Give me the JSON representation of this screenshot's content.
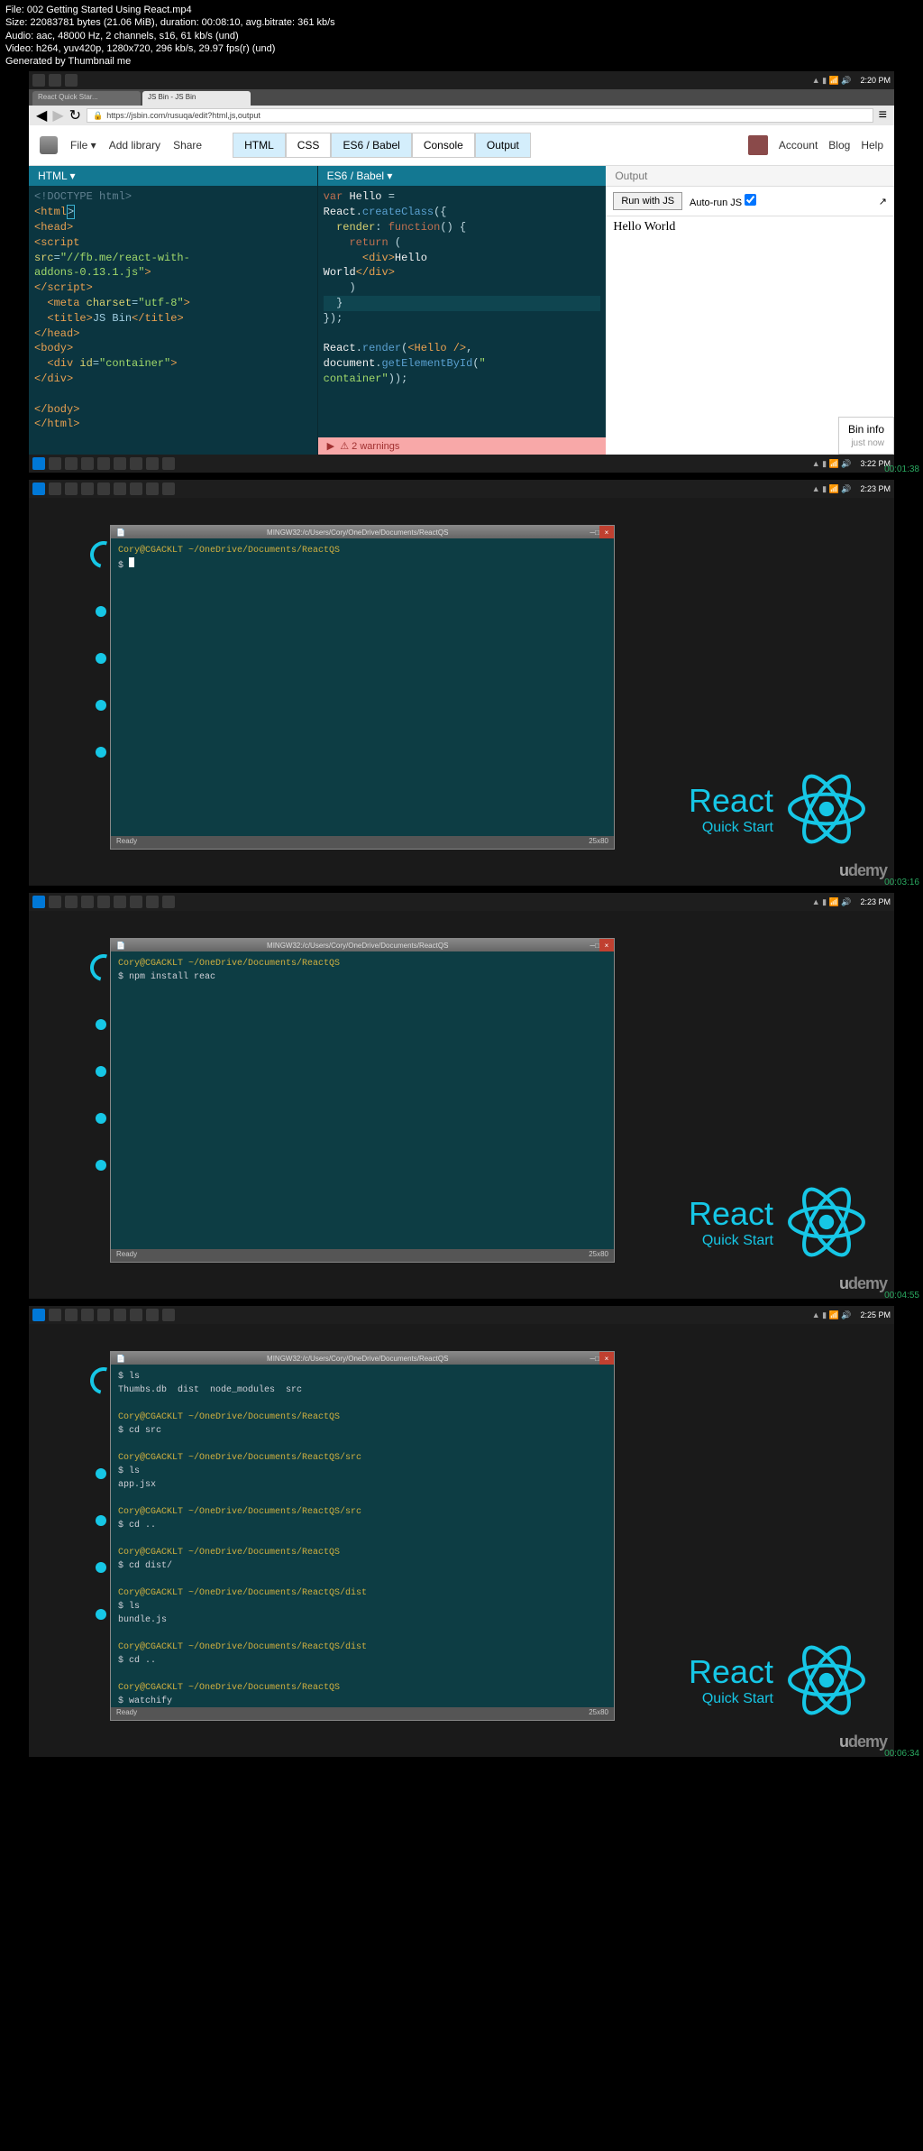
{
  "meta": {
    "file": "File: 002 Getting Started Using React.mp4",
    "size": "Size: 22083781 bytes (21.06 MiB), duration: 00:08:10, avg.bitrate: 361 kb/s",
    "audio": "Audio: aac, 48000 Hz, 2 channels, s16, 61 kb/s (und)",
    "video": "Video: h264, yuv420p, 1280x720, 296 kb/s, 29.97 fps(r) (und)",
    "gen": "Generated by Thumbnail me"
  },
  "frame1": {
    "time": "2:20 PM",
    "timestamp": "00:01:38",
    "taskbar_time": "3:22 PM",
    "addr": "https://jsbin.com/rusuqa/edit?html,js,output",
    "toolbar": {
      "file": "File ▾",
      "addlib": "Add library",
      "share": "Share"
    },
    "tabs": {
      "html": "HTML",
      "css": "CSS",
      "es6": "ES6 / Babel",
      "console": "Console",
      "output": "Output"
    },
    "right": {
      "account": "Account",
      "blog": "Blog",
      "help": "Help"
    },
    "panel_html": "HTML ▾",
    "panel_es6": "ES6 / Babel ▾",
    "panel_output": "Output",
    "run": "Run with JS",
    "autorun": "Auto-run JS",
    "hello": "Hello World",
    "bininfo": "Bin info",
    "bininfo_sub": "just now",
    "warnings": "2 warnings",
    "tab1": "React Quick Star...",
    "tab2": "JS Bin - JS Bin"
  },
  "frame2": {
    "timestamp": "00:03:16",
    "taskbar_time": "2:23 PM",
    "term_title": "MINGW32:/c/Users/Cory/OneDrive/Documents/ReactQS",
    "status": "Ready",
    "status_r": "25x80",
    "prompt": "Cory@CGACKLT ~/OneDrive/Documents/ReactQS",
    "line2": "$ "
  },
  "frame3": {
    "timestamp": "00:04:55",
    "taskbar_time": "2:23 PM",
    "term_title": "MINGW32:/c/Users/Cory/OneDrive/Documents/ReactQS",
    "status": "Ready",
    "status_r": "25x80",
    "prompt": "Cory@CGACKLT ~/OneDrive/Documents/ReactQS",
    "line2": "$ npm install reac"
  },
  "frame4": {
    "timestamp": "00:06:34",
    "taskbar_time": "2:25 PM",
    "term_title": "MINGW32:/c/Users/Cory/OneDrive/Documents/ReactQS",
    "status": "Ready",
    "status_r": "25x80",
    "lines": [
      "$ ls",
      "Thumbs.db  dist  node_modules  src",
      "",
      "~Cory@CGACKLT ~/OneDrive/Documents/ReactQS",
      "$ cd src",
      "",
      "~Cory@CGACKLT ~/OneDrive/Documents/ReactQS/src",
      "$ ls",
      "app.jsx",
      "",
      "~Cory@CGACKLT ~/OneDrive/Documents/ReactQS/src",
      "$ cd ..",
      "",
      "~Cory@CGACKLT ~/OneDrive/Documents/ReactQS",
      "$ cd dist/",
      "",
      "~Cory@CGACKLT ~/OneDrive/Documents/ReactQS/dist",
      "$ ls",
      "bundle.js",
      "",
      "~Cory@CGACKLT ~/OneDrive/Documents/ReactQS/dist",
      "$ cd ..",
      "",
      "~Cory@CGACKLT ~/OneDrive/Documents/ReactQS",
      "$ watchify"
    ]
  },
  "brand": {
    "react": "React",
    "qs": "Quick Start",
    "udemy": "udemy"
  }
}
